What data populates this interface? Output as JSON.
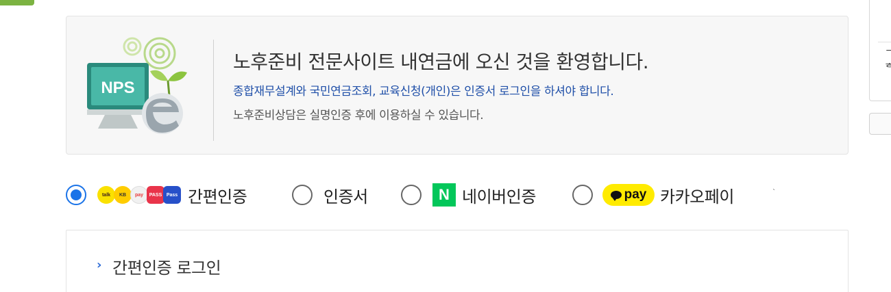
{
  "welcome": {
    "logo_text": "NPS",
    "title": "노후준비 전문사이트 내연금에 오신 것을 환영합니다.",
    "notice_blue": "종합재무설계와 국민연금조회, 교육신청(개인)은 인증서 로그인을 하셔야 합니다.",
    "notice_gray": "노후준비상담은 실명인증 후에 이용하실 수 있습니다."
  },
  "auth_methods": {
    "selected": "simple",
    "options": [
      {
        "id": "simple",
        "label": "간편인증"
      },
      {
        "id": "cert",
        "label": "인증서"
      },
      {
        "id": "naver",
        "label": "네이버인증",
        "logo": "N"
      },
      {
        "id": "kakaopay",
        "label": "카카오페이",
        "logo": "pay"
      }
    ],
    "mini_icons": [
      "kakao-icon",
      "kb-icon",
      "payco-icon",
      "pass-icon",
      "pass-icon"
    ]
  },
  "login_section": {
    "title": "간편인증 로그인"
  },
  "colors": {
    "accent_blue": "#1a73e8",
    "notice_blue": "#1f4fa8",
    "naver_green": "#03c75a",
    "kakao_yellow": "#ffeb00",
    "top_tab_green": "#7cb342"
  }
}
